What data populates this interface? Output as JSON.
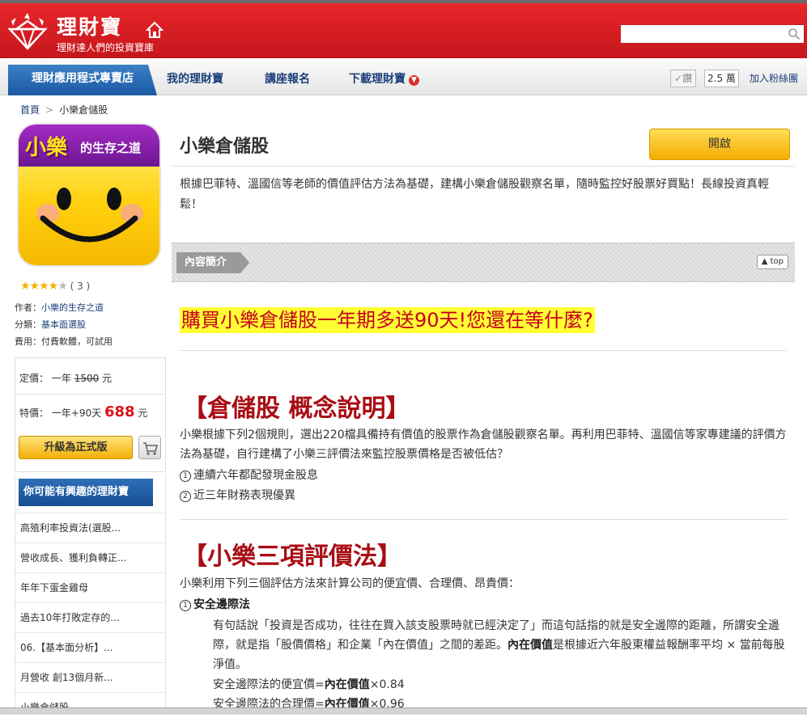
{
  "header": {
    "logo_title": "理財寶",
    "logo_subtitle": "理財達人們的投資寶庫",
    "search_placeholder": ""
  },
  "nav": {
    "active_tab": "理財應用程式專賣店",
    "links": [
      "我的理財寶",
      "講座報名",
      "下載理財寶"
    ],
    "like_label": "讚",
    "like_count": "2.5 萬",
    "fans_label": "加入粉絲團"
  },
  "breadcrumb": {
    "home": "首頁",
    "separator": ">",
    "current": "小樂倉儲股"
  },
  "app": {
    "icon_text_main": "小樂",
    "icon_text_rest": "的生存之道",
    "title": "小樂倉儲股",
    "open_label": "開啟",
    "rating_stars": 4,
    "rating_count": "( 3 )",
    "author_label": "作者：",
    "author": "小樂的生存之道",
    "category_label": "分類：",
    "category": "基本面選股",
    "fee_label": "費用：",
    "fee": "付費軟體，可試用"
  },
  "price": {
    "list_label": "定價：",
    "list_period": "一年",
    "list_value": "1500",
    "list_unit": "元",
    "special_label": "特價：",
    "special_period": "一年+90天",
    "special_value": "688",
    "special_unit": "元",
    "upgrade_label": "升級為正式版"
  },
  "interest": {
    "title": "你可能有興趣的理財寶",
    "items": [
      "高殖利率投資法(選股...",
      "營收成長、獲利負轉正...",
      "年年下蛋金雞母",
      "過去10年打敗定存的...",
      "06.【基本面分析】...",
      "月營收 創13個月新...",
      "小樂倉儲股"
    ]
  },
  "main": {
    "intro": "根據巴菲特、溫國信等老師的價值評估方法為基礎，建構小樂倉儲股觀察名單，隨時監控好股票好買點！長線投資真輕鬆！",
    "section_label": "內容簡介",
    "top_label": "top",
    "promo": "購買小樂倉儲股一年期多送90天!您還在等什麼?",
    "heading1": "【倉儲股 概念說明】",
    "para1": "小樂根據下列2個規則，選出220檔具備持有價值的股票作為倉儲股觀察名單。再利用巴菲特、溫國信等家專建議的評價方法為基礎，自行建構了小樂三評價法來監控股票價格是否被低估？",
    "rule1_num": "1",
    "rule1": "連續六年都配發現金股息",
    "rule2_num": "2",
    "rule2": "近三年財務表現優異",
    "heading2": "【小樂三項評價法】",
    "para2": "小樂利用下列三個評估方法來計算公司的便宜價、合理價、昂貴價：",
    "method1_num": "1",
    "method1": "安全邊際法",
    "method1_desc_a": "有句話說「投資是否成功，往往在買入該支股票時就已經決定了」而這句話指的就是安全邊際的距離，所謂安全邊際，就是指「股價價格」和企業「內在價值」之間的差距。",
    "method1_desc_b_bold": "內在價值",
    "method1_desc_b": "是根據近六年股東權益報酬率平均 × 當前每股淨值。",
    "cheap_prefix": "安全邊際法的便宜價=",
    "cheap_bold": "內在價值",
    "cheap_suffix": "×0.84",
    "fair_prefix": "安全邊際法的合理價=",
    "fair_bold": "內在價值",
    "fair_suffix": "×0.96"
  },
  "colors": {
    "header_red": "#d31b21",
    "nav_blue": "#1c5aa3",
    "heading_red": "#a80d14",
    "promo_yellow": "#ffff33",
    "button_orange": "#f5ad00"
  }
}
